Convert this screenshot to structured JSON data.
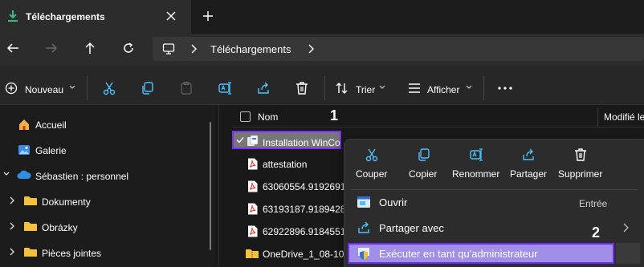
{
  "tab": {
    "title": "Téléchargements",
    "icon": "download-icon",
    "close_icon": "close-icon",
    "new_tab_icon": "plus-icon"
  },
  "nav": {
    "back_icon": "arrow-left-icon",
    "forward_icon": "arrow-right-icon",
    "up_icon": "arrow-up-icon",
    "refresh_icon": "refresh-icon"
  },
  "address": {
    "location_icon": "monitor-icon",
    "crumb": "Téléchargements"
  },
  "toolbar": {
    "new_label": "Nouveau",
    "sort_label": "Trier",
    "view_label": "Afficher",
    "more_icon": "more-icon"
  },
  "sidebar": {
    "items": [
      {
        "label": "Accueil",
        "icon": "home-icon"
      },
      {
        "label": "Galerie",
        "icon": "gallery-icon"
      },
      {
        "label": "Sébastien : personnel",
        "icon": "cloud-icon"
      },
      {
        "label": "Dokumenty",
        "icon": "folder-icon"
      },
      {
        "label": "Obrázky",
        "icon": "folder-icon"
      },
      {
        "label": "Pièces jointes",
        "icon": "folder-icon"
      }
    ]
  },
  "filelist": {
    "header_name": "Nom",
    "header_modified": "Modifié le",
    "marker_1": "1",
    "files": [
      {
        "name": "Installation WinCo",
        "icon": "installer-icon"
      },
      {
        "name": "attestation",
        "icon": "pdf-icon"
      },
      {
        "name": "63060554.91926915.",
        "icon": "pdf-icon"
      },
      {
        "name": "63193187.91894285.",
        "icon": "pdf-icon"
      },
      {
        "name": "62922896.91845512.",
        "icon": "pdf-icon"
      },
      {
        "name": "OneDrive_1_08-10-2",
        "icon": "folder-zip-icon"
      }
    ]
  },
  "context_menu": {
    "actions": [
      {
        "label": "Couper",
        "icon": "scissors-icon"
      },
      {
        "label": "Copier",
        "icon": "copy-icon"
      },
      {
        "label": "Renommer",
        "icon": "rename-icon"
      },
      {
        "label": "Partager",
        "icon": "share-icon"
      },
      {
        "label": "Supprimer",
        "icon": "trash-icon"
      }
    ],
    "items": [
      {
        "label": "Ouvrir",
        "shortcut": "Entrée",
        "icon": "app-window-icon"
      },
      {
        "label": "Partager avec",
        "icon": "share-with-icon",
        "submenu_icon": "chevron-right-icon"
      },
      {
        "label": "Exécuter en tant qu'administrateur",
        "icon": "shield-icon"
      }
    ],
    "marker_2": "2"
  },
  "colors": {
    "highlight_border": "#7b2ff7",
    "highlight_fill": "#a08fe8",
    "folder": "#f4c13c",
    "pdf": "#e0302a",
    "accent": "#4cc2ff"
  }
}
